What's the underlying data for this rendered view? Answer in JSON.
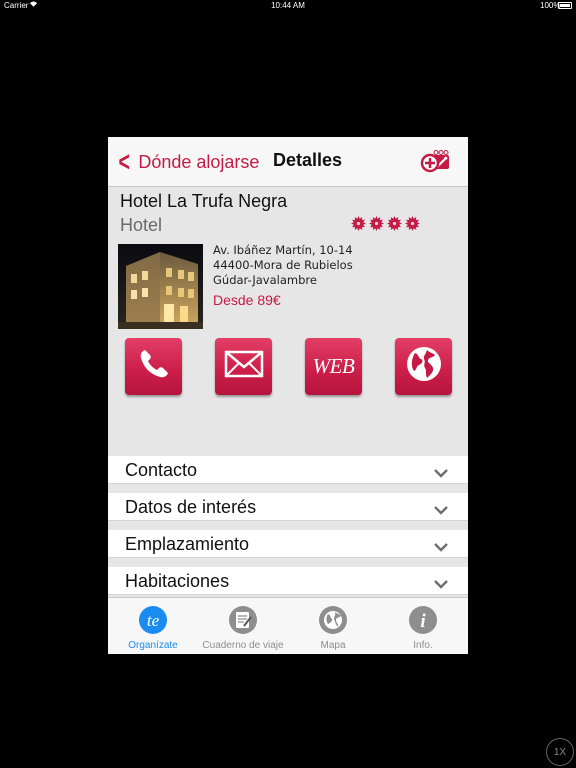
{
  "status_bar": {
    "carrier": "Carrier",
    "time": "10:44 AM",
    "battery": "100%"
  },
  "navbar": {
    "back_label": "Dónde alojarse",
    "title": "Detalles",
    "favorite_icon": "add-favorite-icon"
  },
  "hotel": {
    "name": "Hotel La Trufa Negra",
    "type": "Hotel",
    "stars": 4,
    "address_line1": "Av. Ibáñez Martín, 10-14",
    "address_line2": "44400-Mora de Rubielos",
    "address_line3": "Gúdar-Javalambre",
    "price": "Desde 89€"
  },
  "actions": {
    "phone_icon": "phone-icon",
    "mail_icon": "mail-icon",
    "web_label": "WEB",
    "globe_icon": "globe-icon"
  },
  "sections": [
    {
      "label": "Contacto"
    },
    {
      "label": "Datos de interés"
    },
    {
      "label": "Emplazamiento"
    },
    {
      "label": "Habitaciones"
    }
  ],
  "tabs": [
    {
      "label": "Organízate",
      "active": true
    },
    {
      "label": "Cuaderno de viaje"
    },
    {
      "label": "Mapa"
    },
    {
      "label": "Info."
    }
  ],
  "zoom": "1X",
  "colors": {
    "accent": "#c51a46",
    "tab_active": "#1a8cf0"
  }
}
